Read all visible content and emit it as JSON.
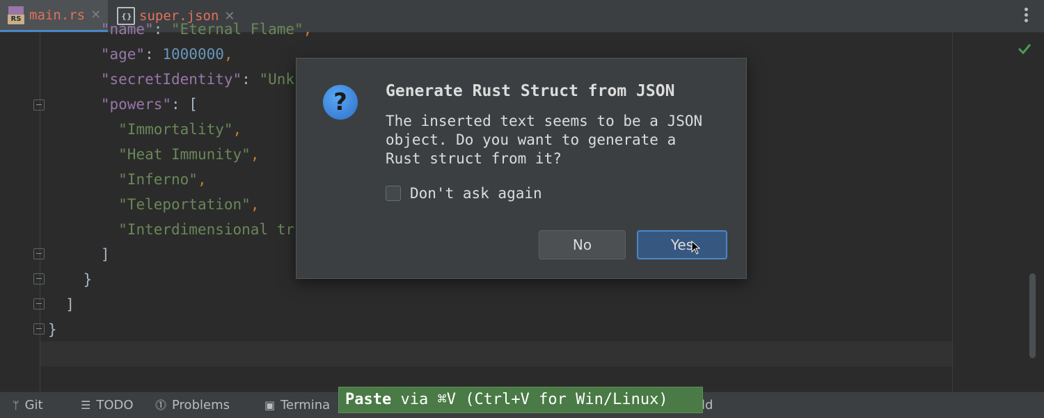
{
  "tabs": [
    {
      "label": "main.rs",
      "icon": "rust-file-icon",
      "badge": "RS",
      "active": true
    },
    {
      "label": "super.json",
      "icon": "json-file-icon",
      "badge": "{}",
      "active": false
    }
  ],
  "editor": {
    "lines": [
      {
        "indent": "      ",
        "parts": [
          {
            "t": "\"name\"",
            "c": "key"
          },
          {
            "t": ": ",
            "c": "plain"
          },
          {
            "t": "\"Eternal Flame\"",
            "c": "str"
          },
          {
            "t": ",",
            "c": "pun"
          }
        ]
      },
      {
        "indent": "      ",
        "parts": [
          {
            "t": "\"age\"",
            "c": "key"
          },
          {
            "t": ": ",
            "c": "plain"
          },
          {
            "t": "1000000",
            "c": "num"
          },
          {
            "t": ",",
            "c": "pun"
          }
        ]
      },
      {
        "indent": "      ",
        "parts": [
          {
            "t": "\"secretIdentity\"",
            "c": "key"
          },
          {
            "t": ": ",
            "c": "plain"
          },
          {
            "t": "\"Unk",
            "c": "str"
          }
        ]
      },
      {
        "indent": "      ",
        "parts": [
          {
            "t": "\"powers\"",
            "c": "key"
          },
          {
            "t": ": [",
            "c": "plain"
          }
        ]
      },
      {
        "indent": "        ",
        "parts": [
          {
            "t": "\"Immortality\"",
            "c": "str"
          },
          {
            "t": ",",
            "c": "pun"
          }
        ]
      },
      {
        "indent": "        ",
        "parts": [
          {
            "t": "\"Heat Immunity\"",
            "c": "str"
          },
          {
            "t": ",",
            "c": "pun"
          }
        ]
      },
      {
        "indent": "        ",
        "parts": [
          {
            "t": "\"Inferno\"",
            "c": "str"
          },
          {
            "t": ",",
            "c": "pun"
          }
        ]
      },
      {
        "indent": "        ",
        "parts": [
          {
            "t": "\"Teleportation\"",
            "c": "str"
          },
          {
            "t": ",",
            "c": "pun"
          }
        ]
      },
      {
        "indent": "        ",
        "parts": [
          {
            "t": "\"Interdimensional tr",
            "c": "str"
          }
        ]
      },
      {
        "indent": "      ",
        "parts": [
          {
            "t": "]",
            "c": "plain"
          }
        ]
      },
      {
        "indent": "    ",
        "parts": [
          {
            "t": "}",
            "c": "plain"
          }
        ]
      },
      {
        "indent": "  ",
        "parts": [
          {
            "t": "]",
            "c": "plain"
          }
        ]
      },
      {
        "indent": "",
        "parts": [
          {
            "t": "}",
            "c": "plain"
          }
        ]
      }
    ],
    "inspection_status": "check-icon"
  },
  "dialog": {
    "title": "Generate Rust Struct from JSON",
    "message": "The inserted text seems to be a JSON\nobject. Do you want to generate a\nRust struct from it?",
    "checkbox_label": "Don't ask again",
    "checkbox_checked": false,
    "no_label": "No",
    "yes_label": "Yes",
    "icon": "question-icon"
  },
  "bottombar": {
    "git": "Git",
    "todo": "TODO",
    "problems": "Problems",
    "terminal": "Termina",
    "extra": "ld"
  },
  "tooltip": {
    "action": "Paste",
    "text": " via ⌘V (Ctrl+V for Win/Linux)"
  },
  "colors": {
    "accent": "#4a88c7",
    "tab_text": "#e3715e",
    "string": "#6a8759",
    "key": "#9876aa",
    "number": "#6897bb",
    "tooltip_bg": "#4a7a45"
  }
}
